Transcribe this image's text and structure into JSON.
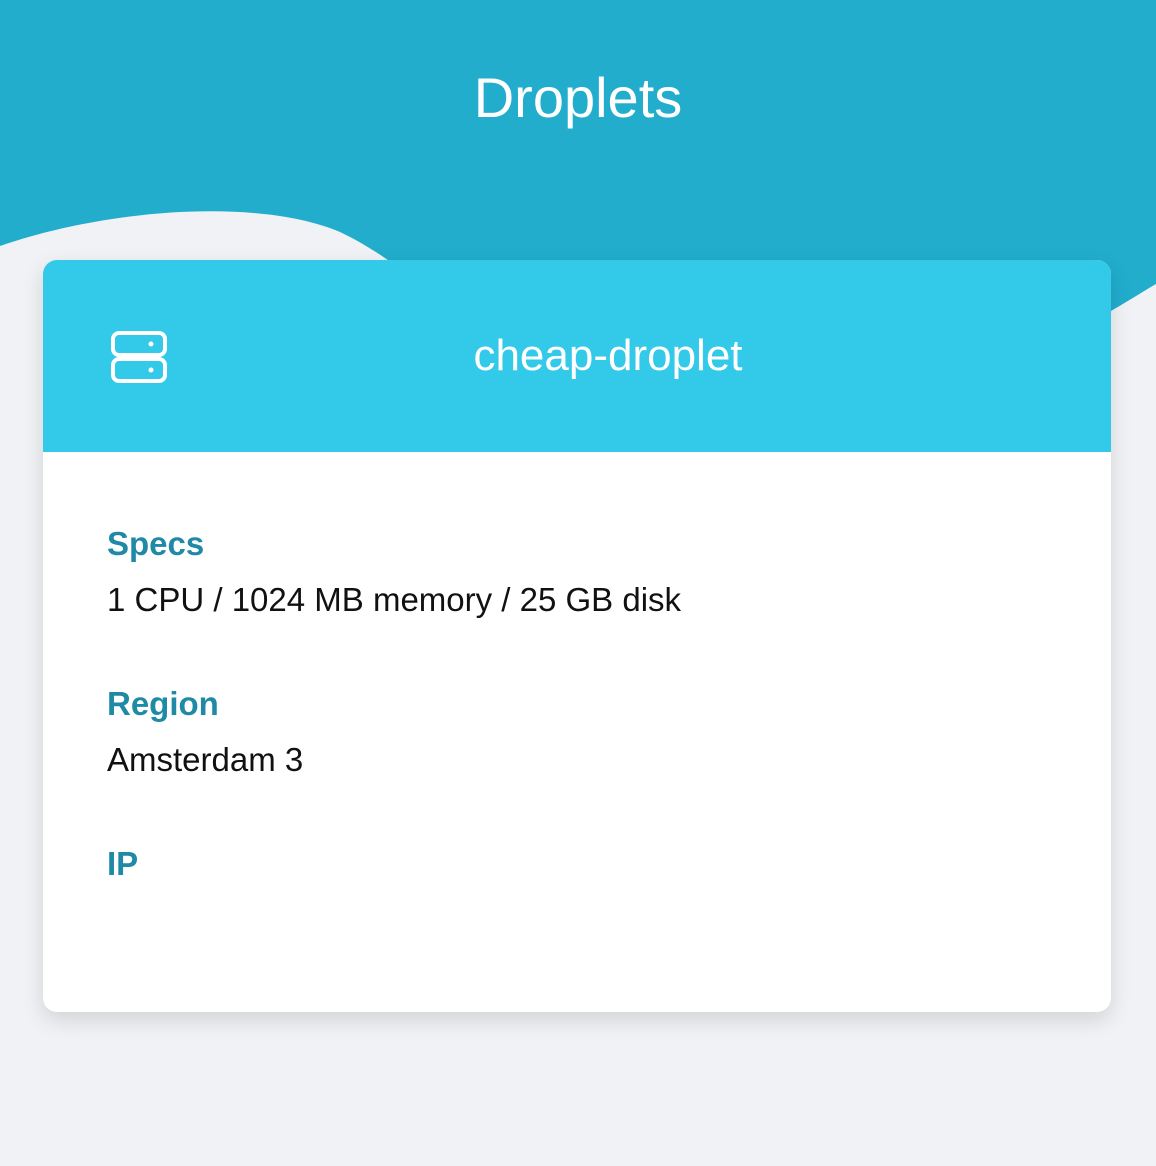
{
  "page": {
    "title": "Droplets"
  },
  "colors": {
    "hero": "#22adcd",
    "card_header": "#33c9e8",
    "label": "#1f8aa6",
    "background": "#f0f2f5"
  },
  "droplet": {
    "icon": "server-icon",
    "name": "cheap-droplet",
    "fields": [
      {
        "label": "Specs",
        "value": "1 CPU / 1024 MB memory / 25 GB disk"
      },
      {
        "label": "Region",
        "value": "Amsterdam 3"
      },
      {
        "label": "IP",
        "value": ""
      }
    ]
  }
}
